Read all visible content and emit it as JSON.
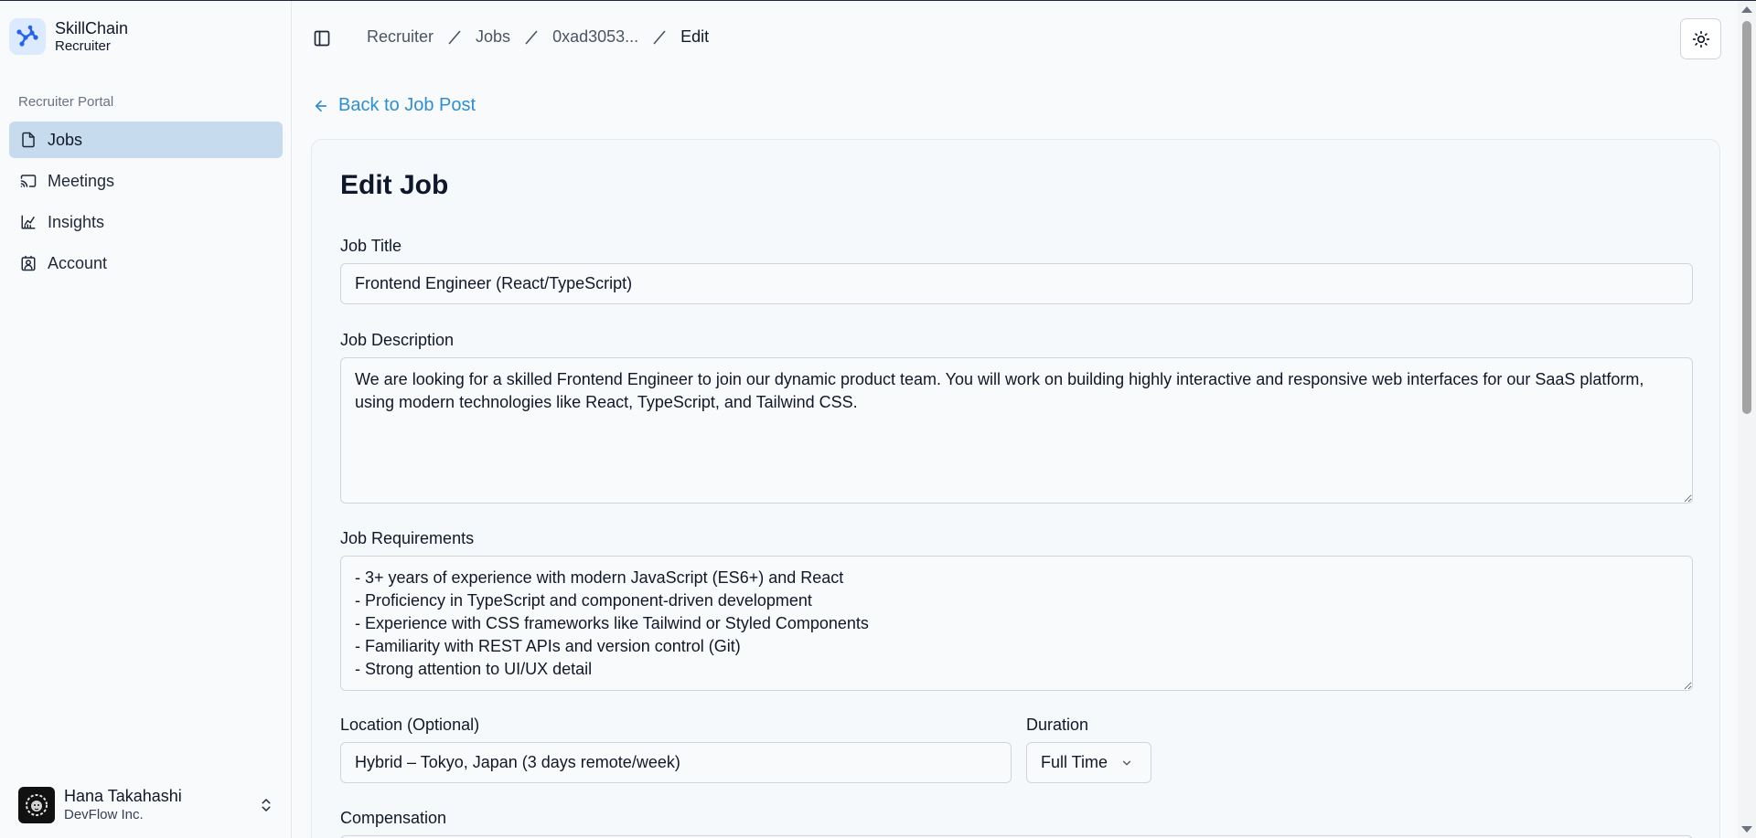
{
  "brand": {
    "name": "SkillChain",
    "subtitle": "Recruiter"
  },
  "sidebar": {
    "group_label": "Recruiter Portal",
    "items": [
      {
        "label": "Jobs",
        "icon": "file-icon",
        "active": true
      },
      {
        "label": "Meetings",
        "icon": "cast-icon",
        "active": false
      },
      {
        "label": "Insights",
        "icon": "chart-icon",
        "active": false
      },
      {
        "label": "Account",
        "icon": "contact-icon",
        "active": false
      }
    ]
  },
  "user": {
    "name": "Hana Takahashi",
    "org": "DevFlow Inc."
  },
  "breadcrumb": [
    "Recruiter",
    "Jobs",
    "0xad3053...",
    "Edit"
  ],
  "back_link": "Back to Job Post",
  "form": {
    "title": "Edit Job",
    "job_title_label": "Job Title",
    "job_title_value": "Frontend Engineer (React/TypeScript)",
    "description_label": "Job Description",
    "description_value": "We are looking for a skilled Frontend Engineer to join our dynamic product team. You will work on building highly interactive and responsive web interfaces for our SaaS platform, using modern technologies like React, TypeScript, and Tailwind CSS.",
    "requirements_label": "Job Requirements",
    "requirements_value": "- 3+ years of experience with modern JavaScript (ES6+) and React\n- Proficiency in TypeScript and component-driven development\n- Experience with CSS frameworks like Tailwind or Styled Components\n- Familiarity with REST APIs and version control (Git)\n- Strong attention to UI/UX detail",
    "location_label": "Location (Optional)",
    "location_value": "Hybrid – Tokyo, Japan (3 days remote/week)",
    "duration_label": "Duration",
    "duration_value": "Full Time",
    "compensation_label": "Compensation"
  },
  "colors": {
    "accent": "#2f8ed3",
    "active_nav": "#c6dbee",
    "brand_logo": "#2563eb"
  }
}
